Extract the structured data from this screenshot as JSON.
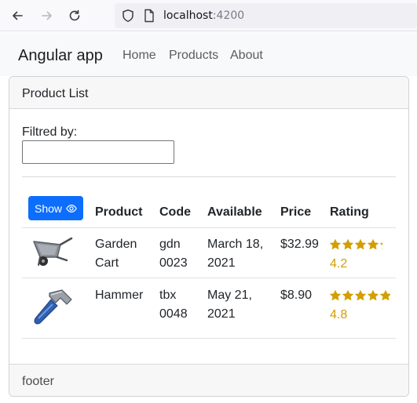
{
  "browser": {
    "url_host": "localhost",
    "url_port": ":4200"
  },
  "navbar": {
    "brand": "Angular app",
    "links": [
      "Home",
      "Products",
      "About"
    ]
  },
  "card": {
    "title": "Product List",
    "footer": "footer"
  },
  "filter": {
    "label": "Filtred by:",
    "value": ""
  },
  "table": {
    "show_button_label": "Show",
    "headers": [
      "Product",
      "Code",
      "Available",
      "Price",
      "Rating"
    ],
    "rows": [
      {
        "image_icon": "garden-cart-icon",
        "name_line1": "Garden",
        "name_line2": "Cart",
        "code_line1": "gdn",
        "code_line2": "0023",
        "available_line1": "March 18,",
        "available_line2": "2021",
        "price": "$32.99",
        "rating_text": "4.2",
        "rating": 4.2
      },
      {
        "image_icon": "hammer-icon",
        "name_line1": "Hammer",
        "name_line2": "",
        "code_line1": "tbx",
        "code_line2": "0048",
        "available_line1": "May 21,",
        "available_line2": "2021",
        "price": "$8.90",
        "rating_text": "4.8",
        "rating": 4.8
      }
    ]
  },
  "colors": {
    "primary": "#0d6efd",
    "star": "#d39e00"
  }
}
